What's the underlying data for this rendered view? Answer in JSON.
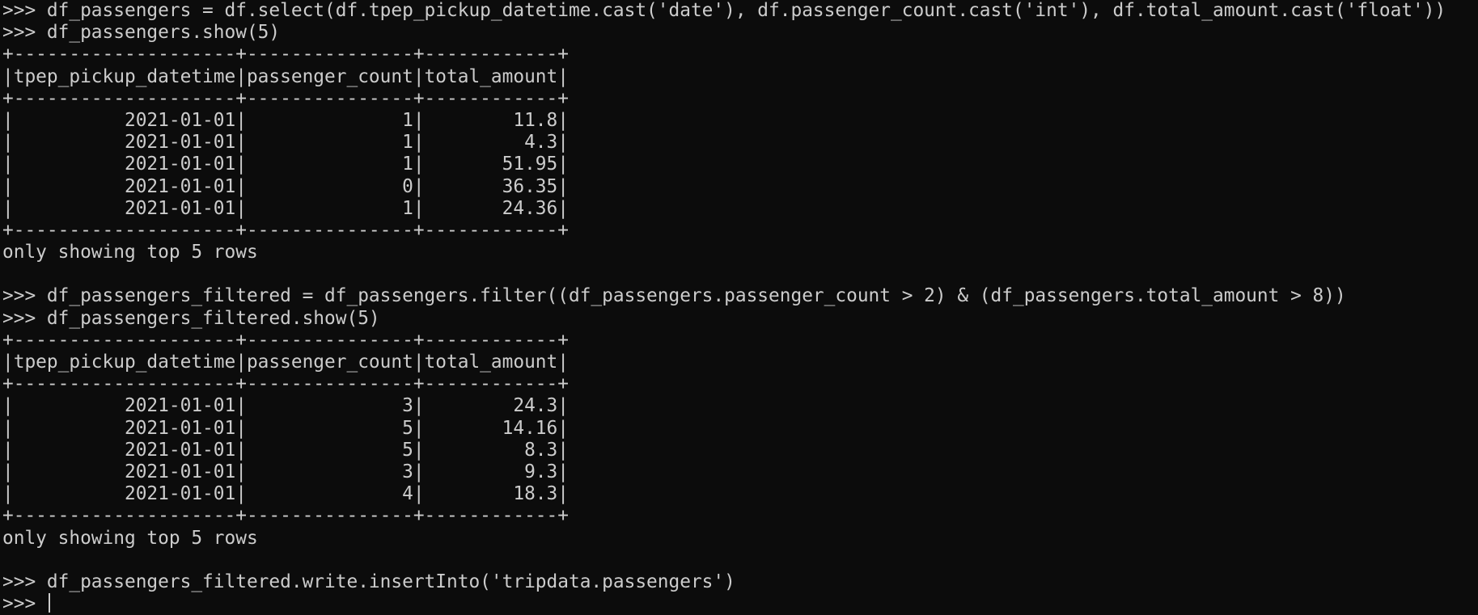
{
  "terminal": {
    "lines": [
      ">>> df_passengers = df.select(df.tpep_pickup_datetime.cast('date'), df.passenger_count.cast('int'), df.total_amount.cast('float'))",
      ">>> df_passengers.show(5)",
      "+--------------------+---------------+------------+",
      "|tpep_pickup_datetime|passenger_count|total_amount|",
      "+--------------------+---------------+------------+",
      "|          2021-01-01|              1|        11.8|",
      "|          2021-01-01|              1|         4.3|",
      "|          2021-01-01|              1|       51.95|",
      "|          2021-01-01|              0|       36.35|",
      "|          2021-01-01|              1|       24.36|",
      "+--------------------+---------------+------------+",
      "only showing top 5 rows",
      "",
      ">>> df_passengers_filtered = df_passengers.filter((df_passengers.passenger_count > 2) & (df_passengers.total_amount > 8))",
      ">>> df_passengers_filtered.show(5)",
      "+--------------------+---------------+------------+",
      "|tpep_pickup_datetime|passenger_count|total_amount|",
      "+--------------------+---------------+------------+",
      "|          2021-01-01|              3|        24.3|",
      "|          2021-01-01|              5|       14.16|",
      "|          2021-01-01|              5|         8.3|",
      "|          2021-01-01|              3|         9.3|",
      "|          2021-01-01|              4|        18.3|",
      "+--------------------+---------------+------------+",
      "only showing top 5 rows",
      "",
      ">>> df_passengers_filtered.write.insertInto('tripdata.passengers')"
    ],
    "prompt": ">>> "
  }
}
